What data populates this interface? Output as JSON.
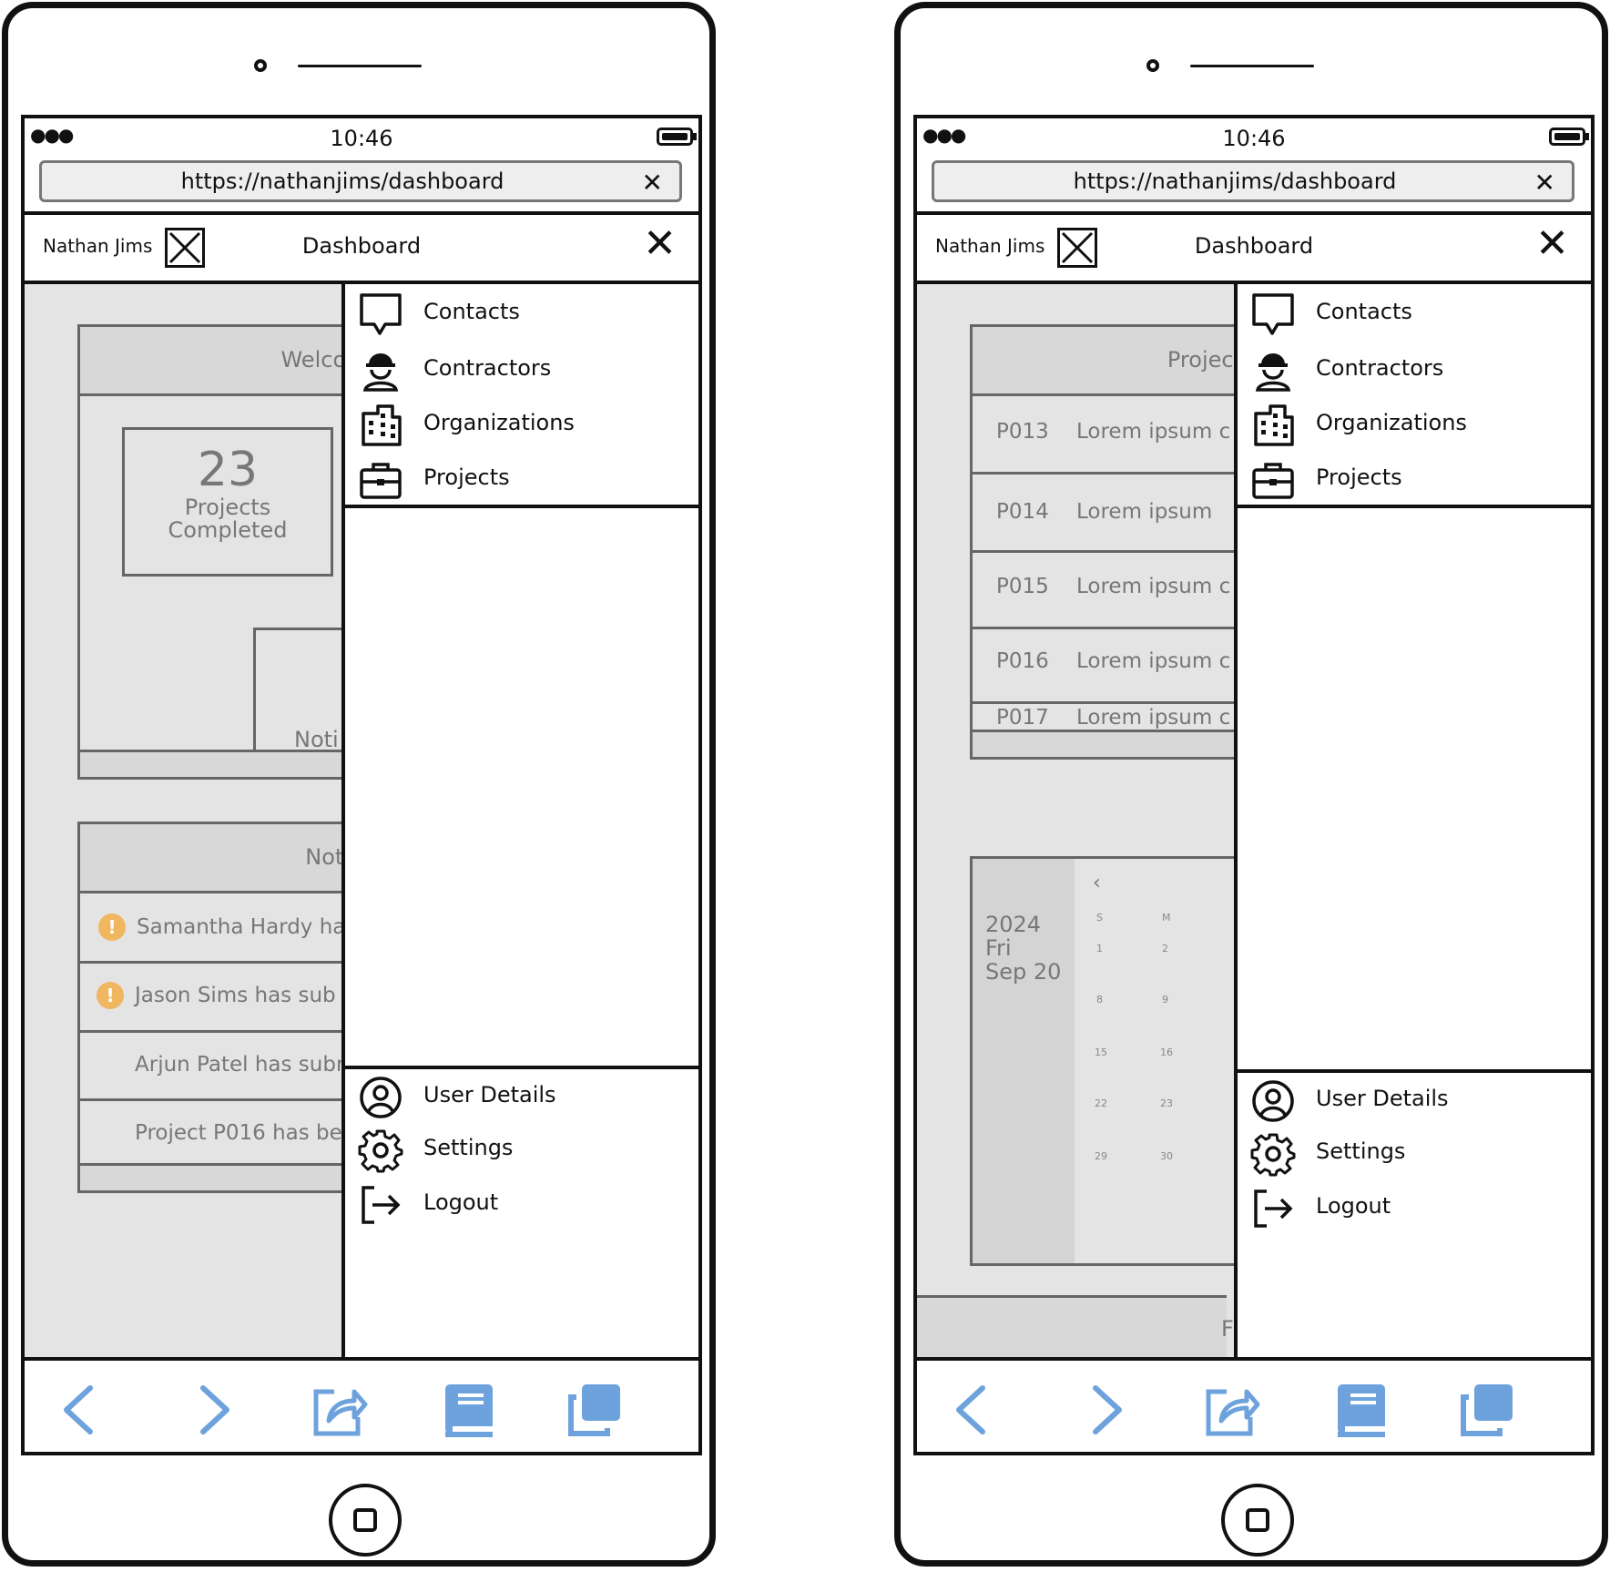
{
  "status": {
    "time": "10:46"
  },
  "browser": {
    "url": "https://nathanjims/dashboard",
    "close_glyph": "✕"
  },
  "header": {
    "user_name": "Nathan Jims",
    "title": "Dashboard",
    "close_glyph": "✕"
  },
  "menu": {
    "items": [
      {
        "label": "Contacts",
        "icon": "chat-bubble-icon"
      },
      {
        "label": "Contractors",
        "icon": "contractor-hardhat-icon"
      },
      {
        "label": "Organizations",
        "icon": "building-icon"
      },
      {
        "label": "Projects",
        "icon": "briefcase-icon"
      }
    ],
    "bottom_items": [
      {
        "label": "User Details",
        "icon": "user-circle-icon"
      },
      {
        "label": "Settings",
        "icon": "gear-icon"
      },
      {
        "label": "Logout",
        "icon": "logout-icon"
      }
    ]
  },
  "left_screen": {
    "welcome_title": "Welcor",
    "stat": {
      "number": "23",
      "label_line1": "Projects",
      "label_line2": "Completed"
    },
    "noti_box_label": "Noti",
    "notifications_title": "Noti",
    "notifications": [
      {
        "text": "Samantha Hardy ha",
        "warning": true,
        "warn_glyph": "!"
      },
      {
        "text": "Jason Sims has sub",
        "warning": true,
        "warn_glyph": "!"
      },
      {
        "text": "Arjun Patel has subr",
        "warning": false
      },
      {
        "text": "Project P016 has be",
        "warning": false
      }
    ]
  },
  "right_screen": {
    "projects_title": "Project",
    "projects": [
      {
        "id": "P013",
        "desc": "Lorem ipsum c"
      },
      {
        "id": "P014",
        "desc": "Lorem ipsum"
      },
      {
        "id": "P015",
        "desc": "Lorem ipsum c"
      },
      {
        "id": "P016",
        "desc": "Lorem ipsum c"
      },
      {
        "id": "P017",
        "desc": "Lorem ipsum c"
      }
    ],
    "calendar": {
      "year": "2024",
      "weekday": "Fri",
      "date": "Sep 20",
      "prev_glyph": "‹",
      "day_headers": [
        "S",
        "M"
      ],
      "weeks": [
        [
          "1",
          "2"
        ],
        [
          "8",
          "9"
        ],
        [
          "15",
          "16"
        ],
        [
          "22",
          "23"
        ],
        [
          "29",
          "30"
        ]
      ]
    },
    "footer_fragment": "F"
  },
  "colors": {
    "accent_blue": "#6ea2dc",
    "warning": "#f0b660",
    "panel_gray": "#e4e4e4"
  },
  "bottom_bar_icons": [
    "back-icon",
    "forward-icon",
    "share-icon",
    "bookmarks-icon",
    "tabs-icon"
  ]
}
